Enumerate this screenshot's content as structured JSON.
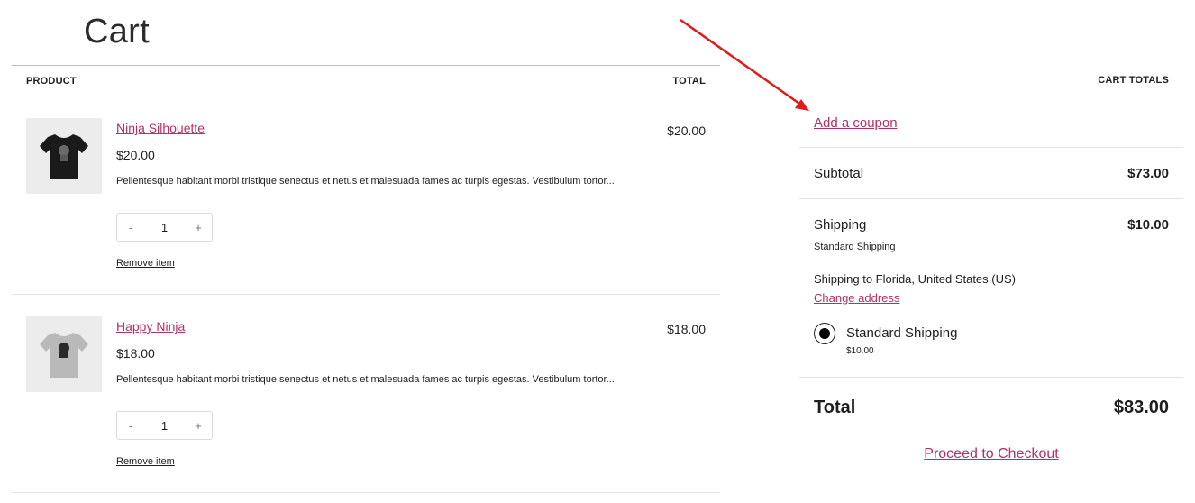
{
  "page": {
    "title": "Cart"
  },
  "table": {
    "product_header": "PRODUCT",
    "total_header": "TOTAL"
  },
  "items": [
    {
      "name": "Ninja Silhouette",
      "price": "$20.00",
      "description": "Pellentesque habitant morbi tristique senectus et netus et malesuada fames ac turpis egestas. Vestibulum tortor...",
      "qty_minus": "-",
      "quantity": "1",
      "qty_plus": "+",
      "remove_label": "Remove item",
      "line_total": "$20.00",
      "shirt_color": "#1a1a1a"
    },
    {
      "name": "Happy Ninja",
      "price": "$18.00",
      "description": "Pellentesque habitant morbi tristique senectus et netus et malesuada fames ac turpis egestas. Vestibulum tortor...",
      "qty_minus": "-",
      "quantity": "1",
      "qty_plus": "+",
      "remove_label": "Remove item",
      "line_total": "$18.00",
      "shirt_color": "#b9b9b9"
    }
  ],
  "totals": {
    "header": "CART TOTALS",
    "coupon_link": "Add a coupon",
    "subtotal_label": "Subtotal",
    "subtotal_value": "$73.00",
    "shipping_label": "Shipping",
    "shipping_value": "$10.00",
    "shipping_method": "Standard Shipping",
    "shipping_destination": "Shipping to Florida, United States (US)",
    "change_address": "Change address",
    "option_name": "Standard Shipping",
    "option_price": "$10.00",
    "total_label": "Total",
    "total_value": "$83.00",
    "checkout_label": "Proceed to Checkout"
  },
  "colors": {
    "link": "#b0306a",
    "annotation_arrow": "#e01b1b"
  }
}
